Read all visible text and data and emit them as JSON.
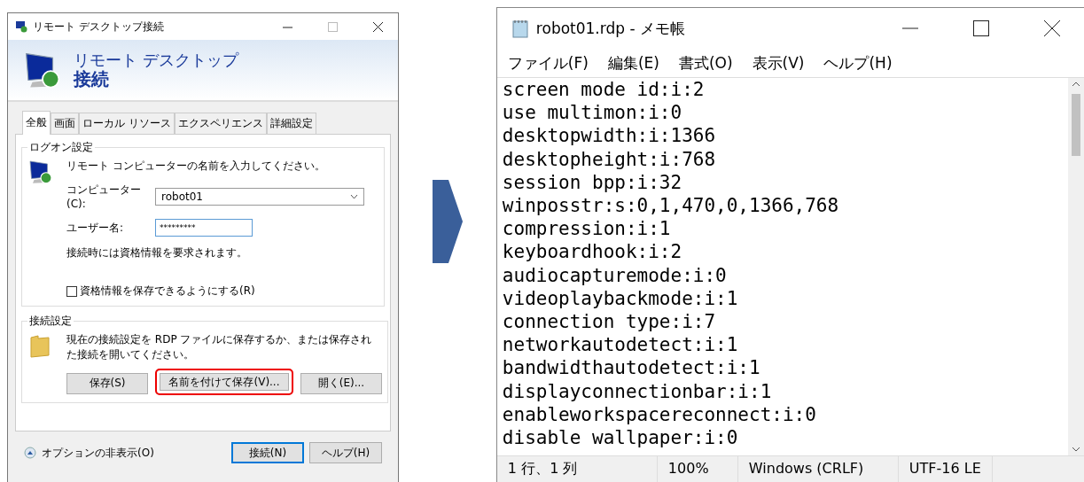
{
  "dialog": {
    "title": "リモート デスクトップ接続",
    "header": [
      "リモート デスクトップ",
      "接続"
    ],
    "tabs": [
      {
        "label": "全般",
        "selected": true
      },
      {
        "label": "画面",
        "selected": false
      },
      {
        "label": "ローカル リソース",
        "selected": false
      },
      {
        "label": "エクスペリエンス",
        "selected": false
      },
      {
        "label": "詳細設定",
        "selected": false
      }
    ],
    "logon": {
      "legend": "ログオン設定",
      "prompt": "リモート コンピューターの名前を入力してください。",
      "computer_label": "コンピューター(C):",
      "computer_value": "robot01",
      "user_label": "ユーザー名:",
      "user_value": "*********",
      "note": "接続時には資格情報を要求されます。",
      "save_credentials": {
        "label": "資格情報を保存できるようにする(R)",
        "checked": false
      }
    },
    "connection": {
      "legend": "接続設定",
      "description": "現在の接続設定を RDP ファイルに保存するか、または保存された接続を開いてください。",
      "buttons": [
        {
          "label": "保存(S)",
          "highlighted": false
        },
        {
          "label": "名前を付けて保存(V)...",
          "highlighted": true
        },
        {
          "label": "開く(E)...",
          "highlighted": false
        }
      ]
    },
    "options_toggle": "オプションの非表示(O)",
    "buttons": [
      {
        "label": "接続(N)",
        "default": true
      },
      {
        "label": "ヘルプ(H)",
        "default": false
      }
    ]
  },
  "notepad": {
    "title": "robot01.rdp - メモ帳",
    "menu": [
      "ファイル(F)",
      "編集(E)",
      "書式(O)",
      "表示(V)",
      "ヘルプ(H)"
    ],
    "lines": [
      "screen mode id:i:2",
      "use multimon:i:0",
      "desktopwidth:i:1366",
      "desktopheight:i:768",
      "session bpp:i:32",
      "winposstr:s:0,1,470,0,1366,768",
      "compression:i:1",
      "keyboardhook:i:2",
      "audiocapturemode:i:0",
      "videoplaybackmode:i:1",
      "connection type:i:7",
      "networkautodetect:i:1",
      "bandwidthautodetect:i:1",
      "displayconnectionbar:i:1",
      "enableworkspacereconnect:i:0",
      "disable wallpaper:i:0"
    ],
    "status_bar": [
      "1 行、1 列",
      "100%",
      "Windows (CRLF)",
      "UTF-16 LE"
    ]
  }
}
